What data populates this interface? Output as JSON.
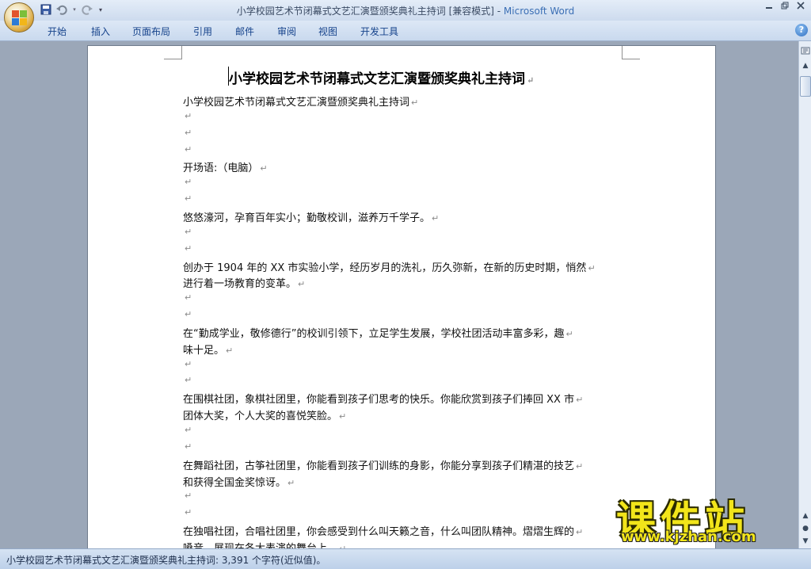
{
  "window": {
    "title": "小学校园艺术节闭幕式文艺汇演暨颁奖典礼主持词 [兼容模式] - ",
    "app_name": "Microsoft Word"
  },
  "quick_access": {
    "items": [
      "save-icon",
      "undo-icon",
      "redo-icon",
      "customize-icon"
    ]
  },
  "window_controls": [
    "minimize",
    "restore",
    "close"
  ],
  "ribbon": {
    "tabs": [
      "开始",
      "插入",
      "页面布局",
      "引用",
      "邮件",
      "审阅",
      "视图",
      "开发工具"
    ],
    "help": "?"
  },
  "document": {
    "title": "小学校园艺术节闭幕式文艺汇演暨颁奖典礼主持词",
    "para_mark": "↵",
    "lines": [
      "小学校园艺术节闭幕式文艺汇演暨颁奖典礼主持词",
      "",
      "",
      "",
      "开场语:（电脑）",
      "",
      "",
      "悠悠濠河，孕育百年实小；勤敬校训，滋养万千学子。",
      "",
      "",
      "创办于 1904 年的 XX 市实验小学，经历岁月的洗礼，历久弥新，在新的历史时期，悄然",
      "进行着一场教育的变革。",
      "",
      "",
      "在“勤成学业，敬修德行”的校训引领下，立足学生发展，学校社团活动丰富多彩，趣",
      "味十足。",
      "",
      "",
      "在围棋社团，象棋社团里，你能看到孩子们思考的快乐。你能欣赏到孩子们捧回 XX 市",
      "团体大奖，个人大奖的喜悦笑脸。",
      "",
      "",
      "在舞蹈社团，古筝社团里，你能看到孩子们训练的身影，你能分享到孩子们精湛的技艺",
      "和获得全国金奖惊讶。",
      "",
      "",
      "在独唱社团，合唱社团里，你会感受到什么叫天籁之音，什么叫团队精神。熠熠生辉的",
      "嗓音，展现在各大表演的舞台上。"
    ]
  },
  "status_bar": {
    "text": "小学校园艺术节闭幕式文艺汇演暨颁奖典礼主持词: 3,391 个字符(近似值)。"
  },
  "watermark": {
    "cn": "课件站",
    "url": "www.kjzhan.com"
  },
  "colors": {
    "title_app": "#3b6fb5",
    "tab_text": "#15428b",
    "watermark": "#f2e51a"
  }
}
